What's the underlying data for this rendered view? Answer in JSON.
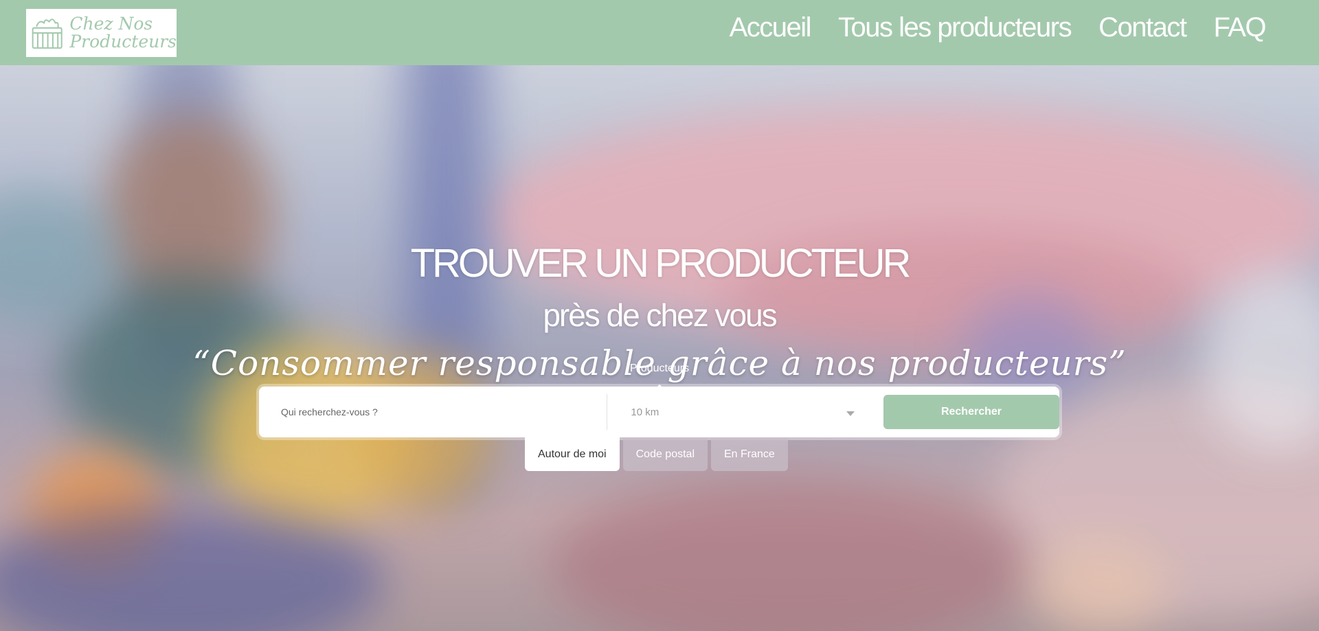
{
  "header": {
    "logo": {
      "line1": "Chez Nos",
      "line2": "Producteurs"
    },
    "nav": [
      {
        "label": "Accueil"
      },
      {
        "label": "Tous les producteurs"
      },
      {
        "label": "Contact"
      },
      {
        "label": "FAQ"
      }
    ]
  },
  "hero": {
    "title": "TROUVER UN PRODUCTEUR",
    "subtitle": "près de chez vous",
    "quote": "“Consommer responsable grâce à nos producteurs”"
  },
  "search": {
    "tab_label": "Producteurs",
    "placeholder": "Qui recherchez-vous ?",
    "distance": "10 km",
    "button_label": "Rechercher",
    "modes": [
      {
        "label": "Autour de moi",
        "active": true
      },
      {
        "label": "Code postal",
        "active": false
      },
      {
        "label": "En France",
        "active": false
      }
    ]
  },
  "colors": {
    "brand_green": "#a3c9ad",
    "white": "#ffffff"
  },
  "icons": {
    "logo": "crate-of-vegetables-icon",
    "select_caret": "chevron-down-icon"
  }
}
